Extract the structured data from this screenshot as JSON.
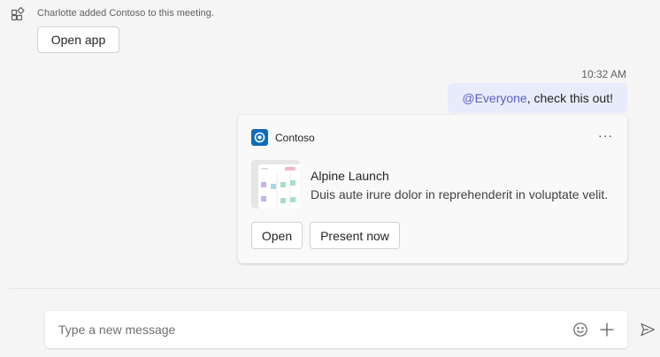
{
  "system_message": {
    "text": "Charlotte added Contoso to this meeting.",
    "button_label": "Open app",
    "icon": "apps-icon"
  },
  "message": {
    "timestamp": "10:32 AM",
    "mention": "@Everyone",
    "text": ", check this out!"
  },
  "card": {
    "app_name": "Contoso",
    "more_label": "···",
    "title": "Alpine Launch",
    "description": "Duis aute irure dolor in reprehenderit in voluptate velit.",
    "buttons": {
      "open": "Open",
      "present": "Present now"
    }
  },
  "compose": {
    "placeholder": "Type a new message",
    "icons": [
      "emoji-icon",
      "add-icon",
      "send-icon"
    ]
  },
  "colors": {
    "accent": "#5b5fc7",
    "brand": "#0f6cbd",
    "bubble": "#e8ebfa"
  }
}
